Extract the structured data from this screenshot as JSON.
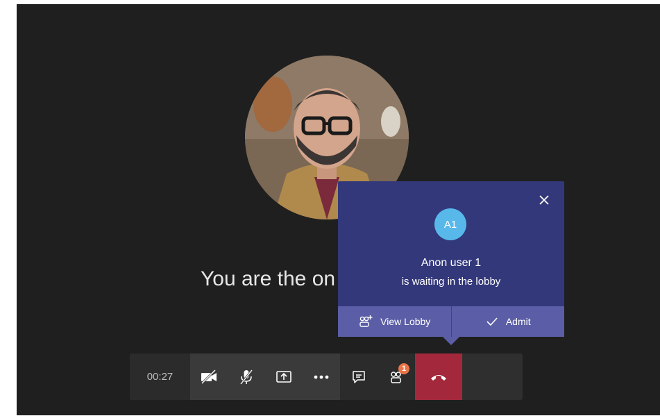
{
  "stage": {
    "status_text": "You are the on"
  },
  "lobby_popup": {
    "avatar_initials": "A1",
    "user_name": "Anon user 1",
    "message": "is waiting in the lobby",
    "view_lobby_label": "View Lobby",
    "admit_label": "Admit",
    "close_icon": "close-icon"
  },
  "call_controls": {
    "timer": "00:27",
    "participants_badge": "1",
    "icons": [
      "video-off-icon",
      "mic-off-icon",
      "share-screen-icon",
      "more-icon",
      "chat-icon",
      "participants-icon",
      "hang-up-icon"
    ]
  },
  "colors": {
    "stage_bg": "#1f1f1f",
    "popup_bg": "#33387b",
    "popup_actions_bg": "#5b5ea6",
    "avatar_bg": "#58b8ea",
    "hangup_bg": "#a4283b",
    "badge_bg": "#e97548"
  }
}
